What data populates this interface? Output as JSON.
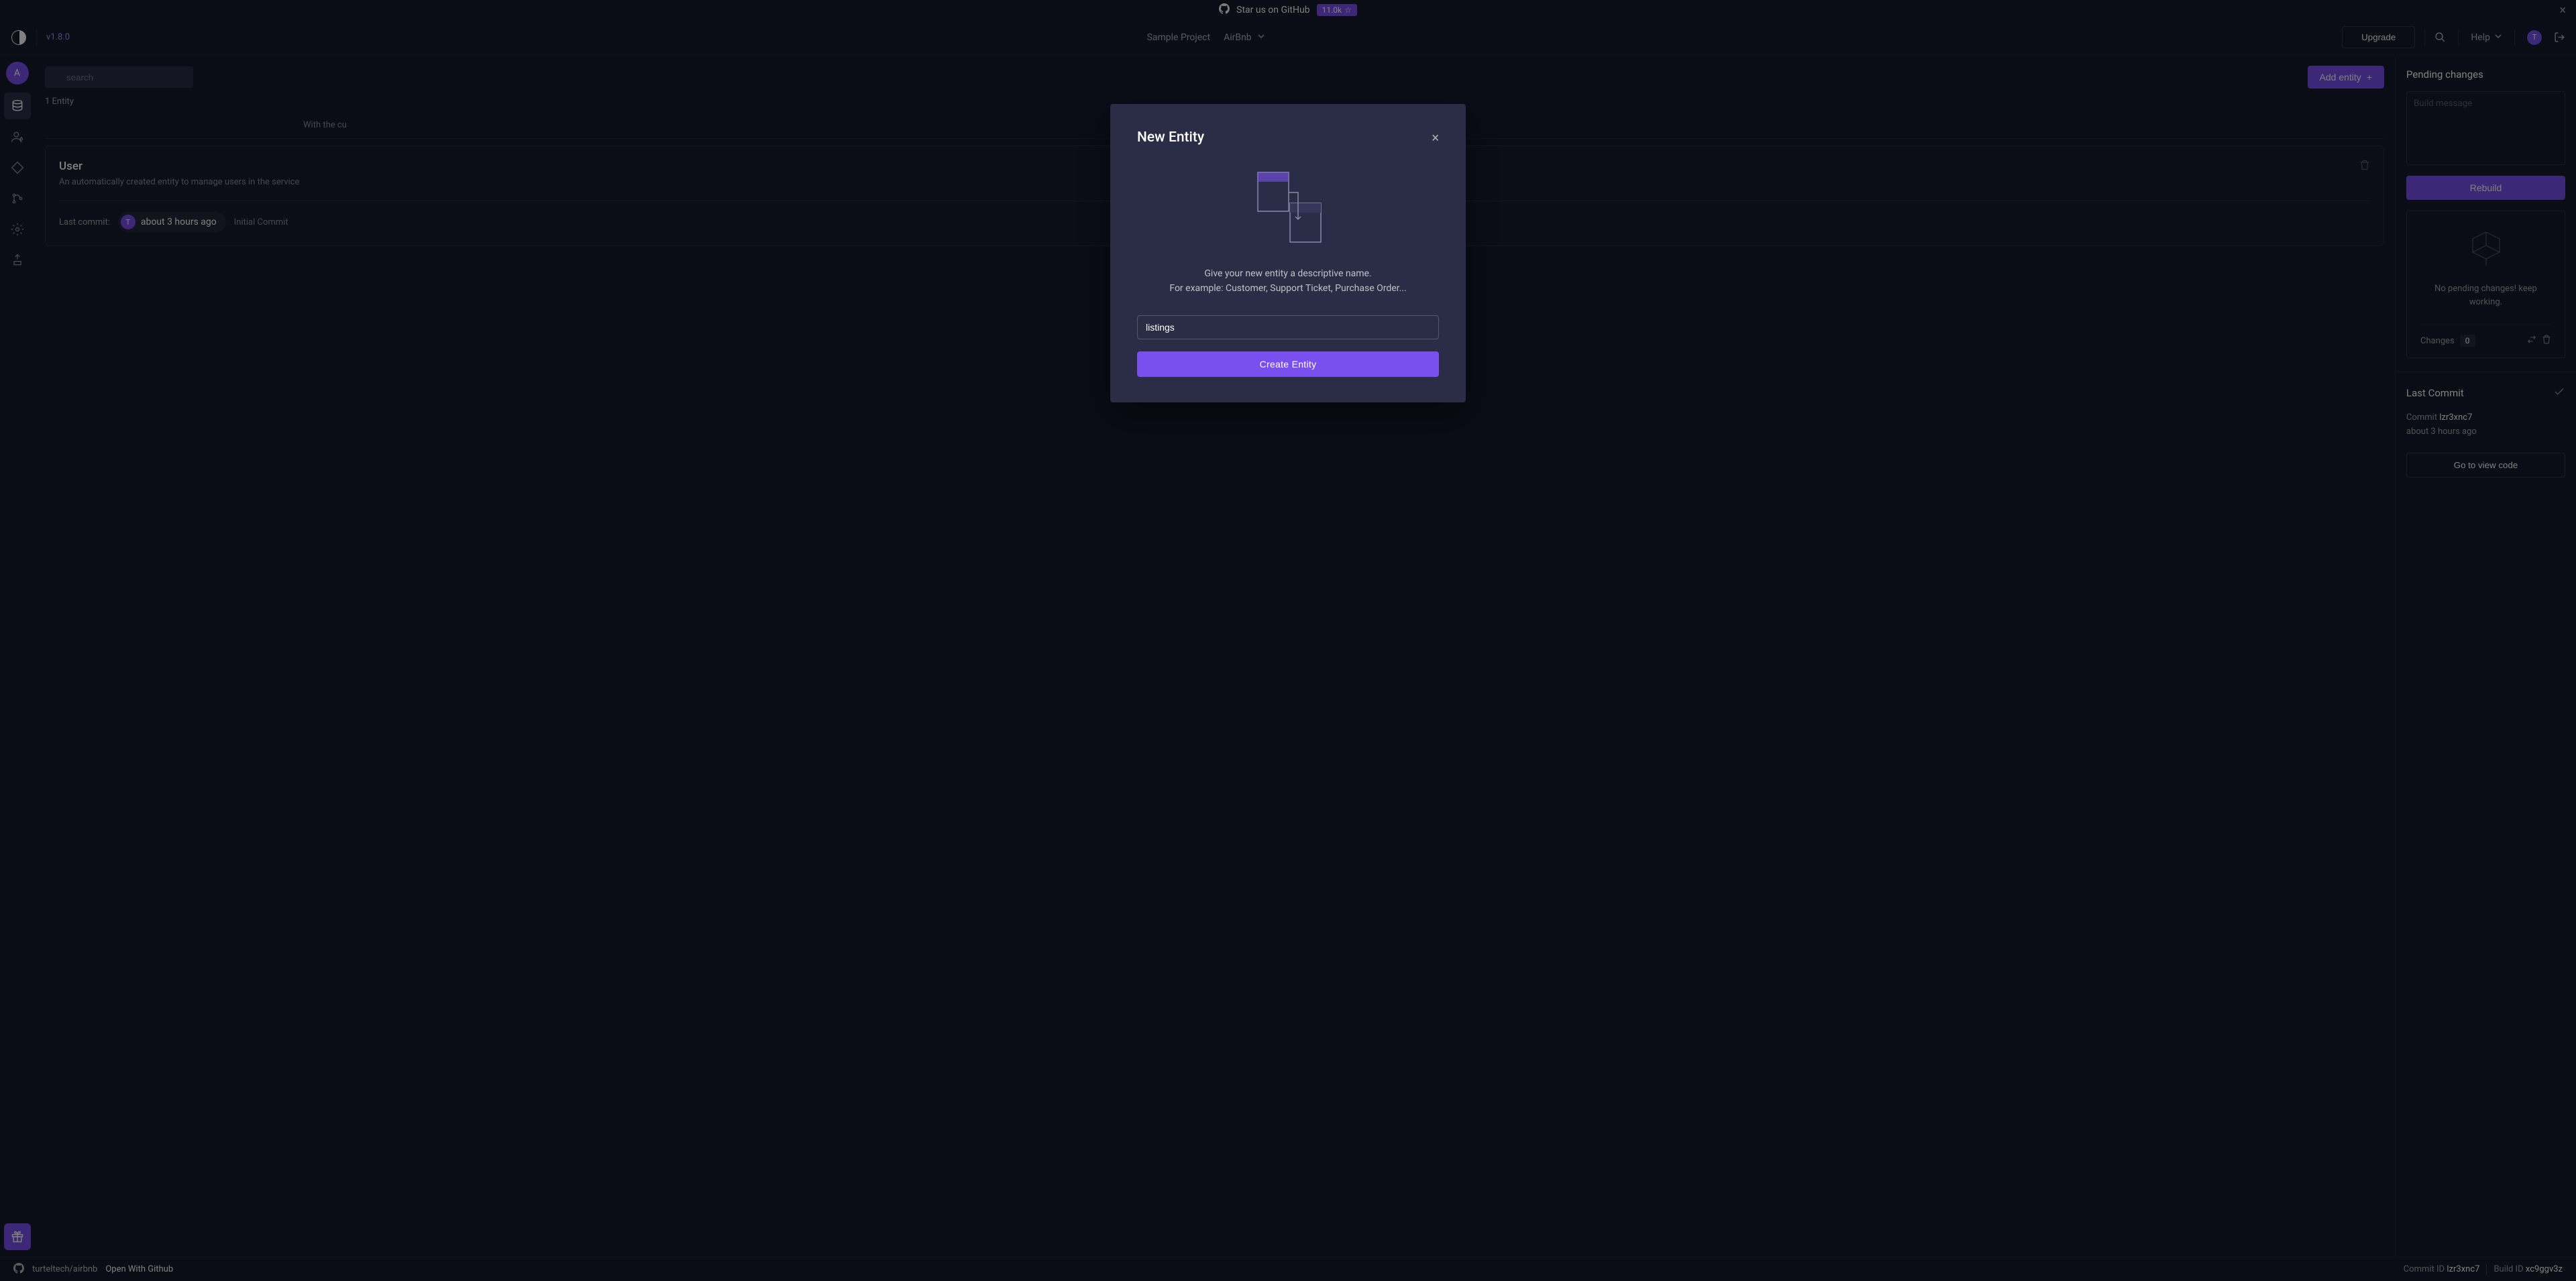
{
  "announce": {
    "text": "Star us on GitHub",
    "stars": "11.0k"
  },
  "header": {
    "version": "v1.8.0",
    "project": "Sample Project",
    "workspace": "AirBnb",
    "upgrade": "Upgrade",
    "help": "Help",
    "avatar_initial": "T"
  },
  "sidebar": {
    "avatar": "A"
  },
  "toolbar": {
    "search_placeholder": "search",
    "add_entity": "Add entity",
    "entity_count": "1 Entity",
    "banner_fragment": "With the cu"
  },
  "entity_card": {
    "name": "User",
    "desc": "An automatically created entity to manage users in the service",
    "last_commit_label": "Last commit:",
    "commit_avatar": "T",
    "commit_time": "about 3 hours ago",
    "commit_msg": "Initial Commit"
  },
  "right": {
    "pending_title": "Pending changes",
    "build_placeholder": "Build message",
    "rebuild": "Rebuild",
    "empty_text": "No pending changes! keep working.",
    "changes_label": "Changes",
    "changes_count": "0",
    "last_commit_title": "Last Commit",
    "commit_label": "Commit",
    "commit_id": "lzr3xnc7",
    "commit_time": "about 3 hours ago",
    "view_code": "Go to view code"
  },
  "footer": {
    "repo": "turteltech/airbnb",
    "open": "Open With Github",
    "commit_id_label": "Commit ID",
    "commit_id": "lzr3xnc7",
    "build_id_label": "Build ID",
    "build_id": "xc9ggv3z"
  },
  "modal": {
    "title": "New Entity",
    "hint1": "Give your new entity a descriptive name.",
    "hint2": "For example: Customer, Support Ticket, Purchase Order...",
    "input_value": "listings",
    "submit": "Create Entity"
  }
}
